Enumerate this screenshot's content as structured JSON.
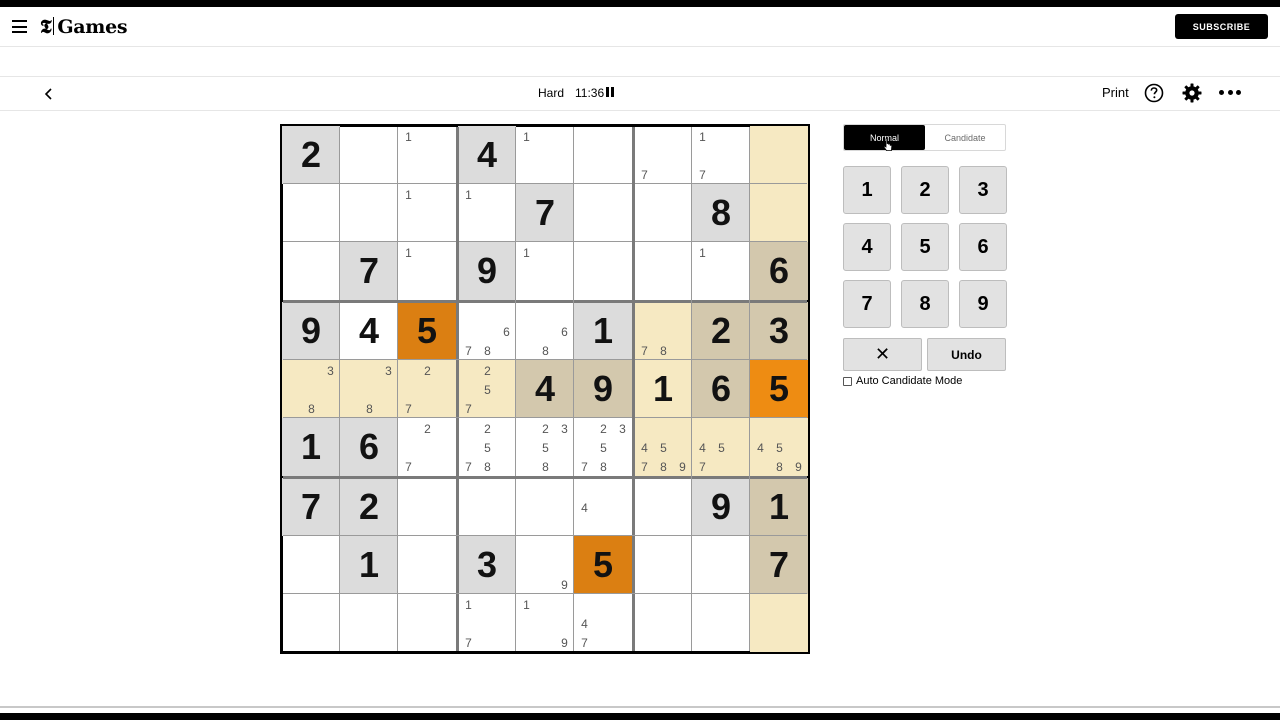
{
  "header": {
    "logo_mark": "𝕿",
    "logo_text": "Games",
    "subscribe_label": "SUBSCRIBE"
  },
  "toolbar": {
    "difficulty": "Hard",
    "timer": "11:36",
    "print_label": "Print"
  },
  "colors": {
    "given_bg": "#dcdcdc",
    "peer_bg": "#f6e9c2",
    "peer_given_bg": "#d3c8ad",
    "conflict_dark": "#db7f12",
    "selected": "#ee8c12"
  },
  "board": {
    "cells": [
      [
        {
          "v": "2",
          "s": "given"
        },
        {
          "v": ""
        },
        {
          "v": "",
          "c": [
            "1"
          ]
        },
        {
          "v": "4",
          "s": "given"
        },
        {
          "v": "",
          "c": [
            "1"
          ]
        },
        {
          "v": ""
        },
        {
          "v": "",
          "c": [
            "7"
          ]
        },
        {
          "v": "",
          "c": [
            "1",
            "7"
          ]
        },
        {
          "v": "",
          "s": "peer"
        }
      ],
      [
        {
          "v": ""
        },
        {
          "v": ""
        },
        {
          "v": "",
          "c": [
            "1"
          ]
        },
        {
          "v": "",
          "c": [
            "1"
          ]
        },
        {
          "v": "7",
          "s": "given"
        },
        {
          "v": ""
        },
        {
          "v": ""
        },
        {
          "v": "8",
          "s": "given"
        },
        {
          "v": "",
          "s": "peer"
        }
      ],
      [
        {
          "v": ""
        },
        {
          "v": "7",
          "s": "given"
        },
        {
          "v": "",
          "c": [
            "1"
          ]
        },
        {
          "v": "9",
          "s": "given"
        },
        {
          "v": "",
          "c": [
            "1"
          ]
        },
        {
          "v": ""
        },
        {
          "v": ""
        },
        {
          "v": "",
          "c": [
            "1"
          ]
        },
        {
          "v": "6",
          "s": "peergiven"
        }
      ],
      [
        {
          "v": "9",
          "s": "given"
        },
        {
          "v": "4"
        },
        {
          "v": "5",
          "s": "conflict"
        },
        {
          "v": "",
          "c": [
            "6",
            "7",
            "8"
          ]
        },
        {
          "v": "",
          "c": [
            "6",
            "8"
          ]
        },
        {
          "v": "1",
          "s": "given"
        },
        {
          "v": "",
          "s": "peer",
          "c": [
            "7",
            "8"
          ]
        },
        {
          "v": "2",
          "s": "peergiven"
        },
        {
          "v": "3",
          "s": "peergiven"
        }
      ],
      [
        {
          "v": "",
          "s": "peer",
          "c": [
            "3",
            "8"
          ]
        },
        {
          "v": "",
          "s": "peer",
          "c": [
            "3",
            "8"
          ]
        },
        {
          "v": "",
          "s": "peer",
          "c": [
            "2",
            "7"
          ]
        },
        {
          "v": "",
          "s": "peer",
          "c": [
            "2",
            "5",
            "7"
          ]
        },
        {
          "v": "4",
          "s": "peergiven"
        },
        {
          "v": "9",
          "s": "peergiven"
        },
        {
          "v": "1",
          "s": "peer"
        },
        {
          "v": "6",
          "s": "peergiven"
        },
        {
          "v": "5",
          "s": "selected"
        }
      ],
      [
        {
          "v": "1",
          "s": "given"
        },
        {
          "v": "6",
          "s": "given"
        },
        {
          "v": "",
          "c": [
            "2",
            "7"
          ]
        },
        {
          "v": "",
          "c": [
            "2",
            "5",
            "7",
            "8"
          ]
        },
        {
          "v": "",
          "c": [
            "2",
            "3",
            "5",
            "8"
          ]
        },
        {
          "v": "",
          "c": [
            "2",
            "3",
            "5",
            "7",
            "8"
          ]
        },
        {
          "v": "",
          "s": "peer",
          "c": [
            "4",
            "5",
            "7",
            "8",
            "9"
          ]
        },
        {
          "v": "",
          "s": "peer",
          "c": [
            "4",
            "5",
            "7"
          ]
        },
        {
          "v": "",
          "s": "peer",
          "c": [
            "4",
            "5",
            "8",
            "9"
          ]
        }
      ],
      [
        {
          "v": "7",
          "s": "given"
        },
        {
          "v": "2",
          "s": "given"
        },
        {
          "v": ""
        },
        {
          "v": ""
        },
        {
          "v": ""
        },
        {
          "v": "",
          "c": [
            "4"
          ]
        },
        {
          "v": ""
        },
        {
          "v": "9",
          "s": "given"
        },
        {
          "v": "1",
          "s": "peergiven"
        }
      ],
      [
        {
          "v": ""
        },
        {
          "v": "1",
          "s": "given"
        },
        {
          "v": ""
        },
        {
          "v": "3",
          "s": "given"
        },
        {
          "v": "",
          "c": [
            "9"
          ]
        },
        {
          "v": "5",
          "s": "conflict"
        },
        {
          "v": ""
        },
        {
          "v": ""
        },
        {
          "v": "7",
          "s": "peergiven"
        }
      ],
      [
        {
          "v": ""
        },
        {
          "v": ""
        },
        {
          "v": ""
        },
        {
          "v": "",
          "c": [
            "1",
            "7"
          ]
        },
        {
          "v": "",
          "c": [
            "1",
            "9"
          ]
        },
        {
          "v": "",
          "c": [
            "4",
            "7"
          ]
        },
        {
          "v": ""
        },
        {
          "v": ""
        },
        {
          "v": "",
          "s": "peer"
        }
      ]
    ]
  },
  "panel": {
    "mode_normal": "Normal",
    "mode_candidate": "Candidate",
    "keys": [
      "1",
      "2",
      "3",
      "4",
      "5",
      "6",
      "7",
      "8",
      "9"
    ],
    "erase_icon": "✕",
    "undo_label": "Undo",
    "auto_candidate_label": "Auto Candidate Mode"
  }
}
